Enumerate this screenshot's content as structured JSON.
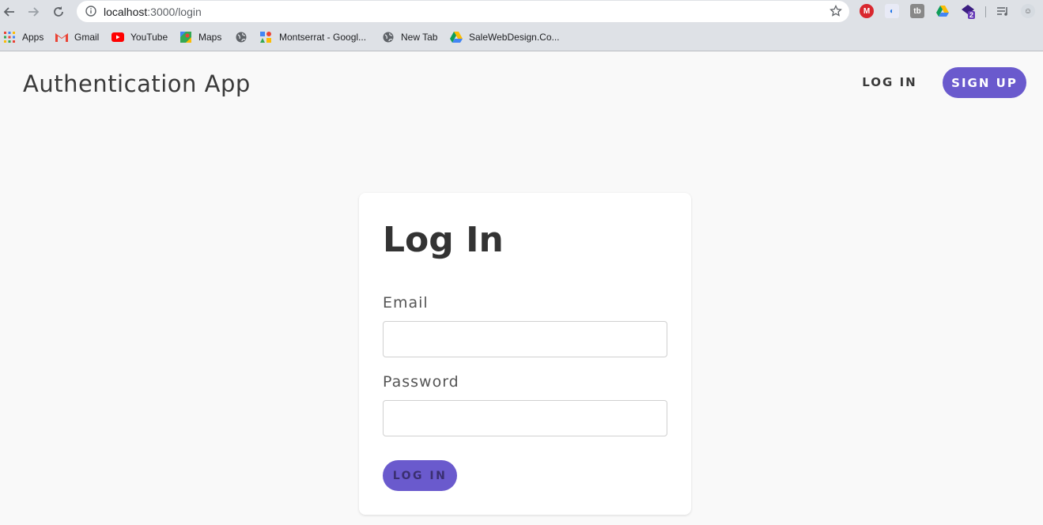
{
  "browser": {
    "url_host": "localhost",
    "url_path": ":3000/login",
    "extensions": [
      "mega-icon",
      "puzzle-extension-icon",
      "tb-extension-icon",
      "drive-icon",
      "badge-extension-icon",
      "reading-list-icon",
      "profile-avatar"
    ],
    "extension_badge": "2"
  },
  "bookmarks": [
    {
      "label": "Apps",
      "icon": "apps-grid-icon"
    },
    {
      "label": "Gmail",
      "icon": "gmail-icon"
    },
    {
      "label": "YouTube",
      "icon": "youtube-icon"
    },
    {
      "label": "Maps",
      "icon": "maps-icon"
    },
    {
      "label": "",
      "icon": "globe-icon"
    },
    {
      "label": "Montserrat - Googl...",
      "icon": "google-fonts-icon"
    },
    {
      "label": "New Tab",
      "icon": "globe-icon"
    },
    {
      "label": "SaleWebDesign.Co...",
      "icon": "drive-icon"
    }
  ],
  "header": {
    "title": "Authentication App",
    "login_label": "LOG IN",
    "signup_label": "SIGN UP"
  },
  "login_form": {
    "title": "Log In",
    "email_label": "Email",
    "email_value": "",
    "password_label": "Password",
    "password_value": "",
    "submit_label": "LOG IN"
  },
  "colors": {
    "accent": "#6a5acd",
    "page_bg": "#f9f9f9",
    "chrome_bg": "#dee1e6"
  }
}
